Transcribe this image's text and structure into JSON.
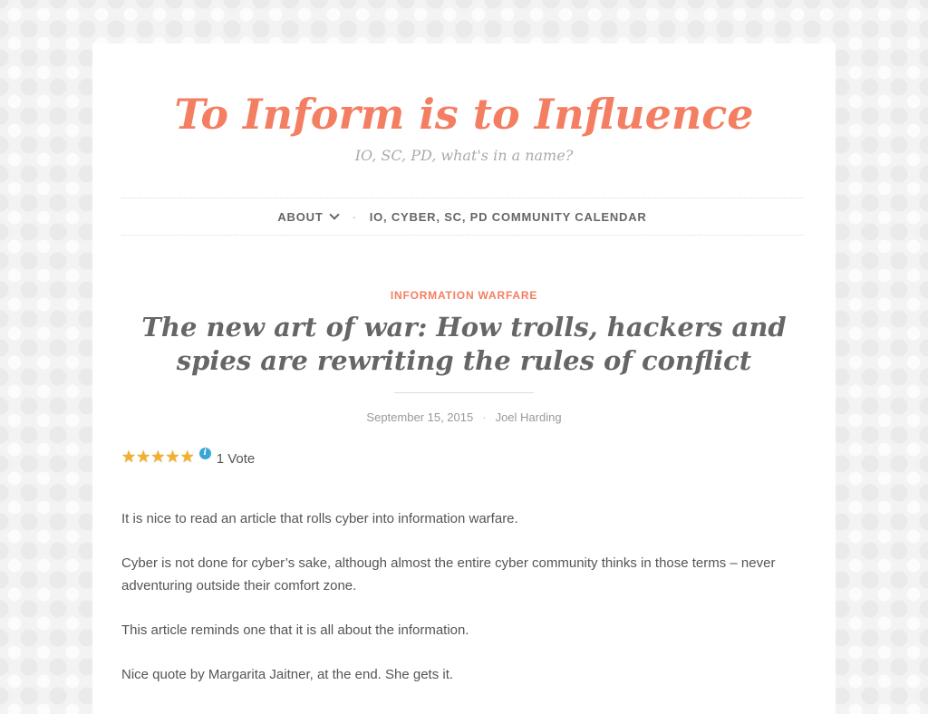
{
  "site": {
    "title": "To Inform is to Influence",
    "description": "IO, SC, PD, what's in a name?",
    "accent_color": "#f47e62"
  },
  "nav": {
    "items": [
      {
        "label": "About",
        "has_dropdown": true,
        "icon": "chevron-down-icon"
      },
      {
        "label": "IO, Cyber, SC, PD Community Calendar",
        "has_dropdown": false
      }
    ],
    "separator": "·"
  },
  "post": {
    "category": "Information Warfare",
    "title": "The new art of war: How trolls, hackers and spies are rewriting the rules of conflict",
    "date": "September 15, 2015",
    "separator": "·",
    "author": "Joel Harding",
    "rating": {
      "stars": 5,
      "max_stars": 5,
      "star_glyph": "★",
      "info_glyph": "i",
      "votes_label": "1 Vote"
    },
    "paragraphs": [
      "It is nice to read an article that rolls cyber into information warfare.",
      "Cyber is not done for cyber’s sake, although almost the entire cyber community thinks in those terms – never adventuring outside their comfort zone.",
      "This article reminds one that it is all about the information.",
      "Nice quote by Margarita Jaitner, at the end. She gets it."
    ]
  }
}
